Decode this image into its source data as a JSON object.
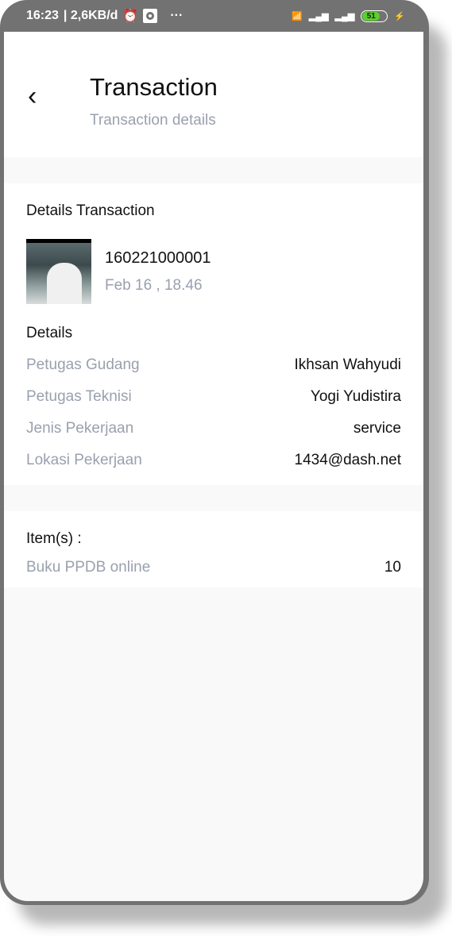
{
  "status_bar": {
    "time": "16:23",
    "speed": "| 2,6KB/d",
    "more": "···",
    "battery": "51"
  },
  "header": {
    "title": "Transaction",
    "subtitle": "Transaction details"
  },
  "details": {
    "heading": "Details Transaction",
    "transaction_id": "160221000001",
    "date": "Feb 16 , 18.46",
    "section": "Details",
    "rows": [
      {
        "label": "Petugas Gudang",
        "value": "Ikhsan Wahyudi"
      },
      {
        "label": "Petugas Teknisi",
        "value": "Yogi Yudistira"
      },
      {
        "label": "Jenis Pekerjaan",
        "value": "service"
      },
      {
        "label": "Lokasi Pekerjaan",
        "value": "1434@dash.net"
      }
    ]
  },
  "items": {
    "heading": "Item(s) :",
    "list": [
      {
        "name": "Buku PPDB online",
        "qty": "10"
      }
    ]
  },
  "colors": {
    "accent_gray": "#9aa0ae",
    "battery": "#5bd02b"
  }
}
